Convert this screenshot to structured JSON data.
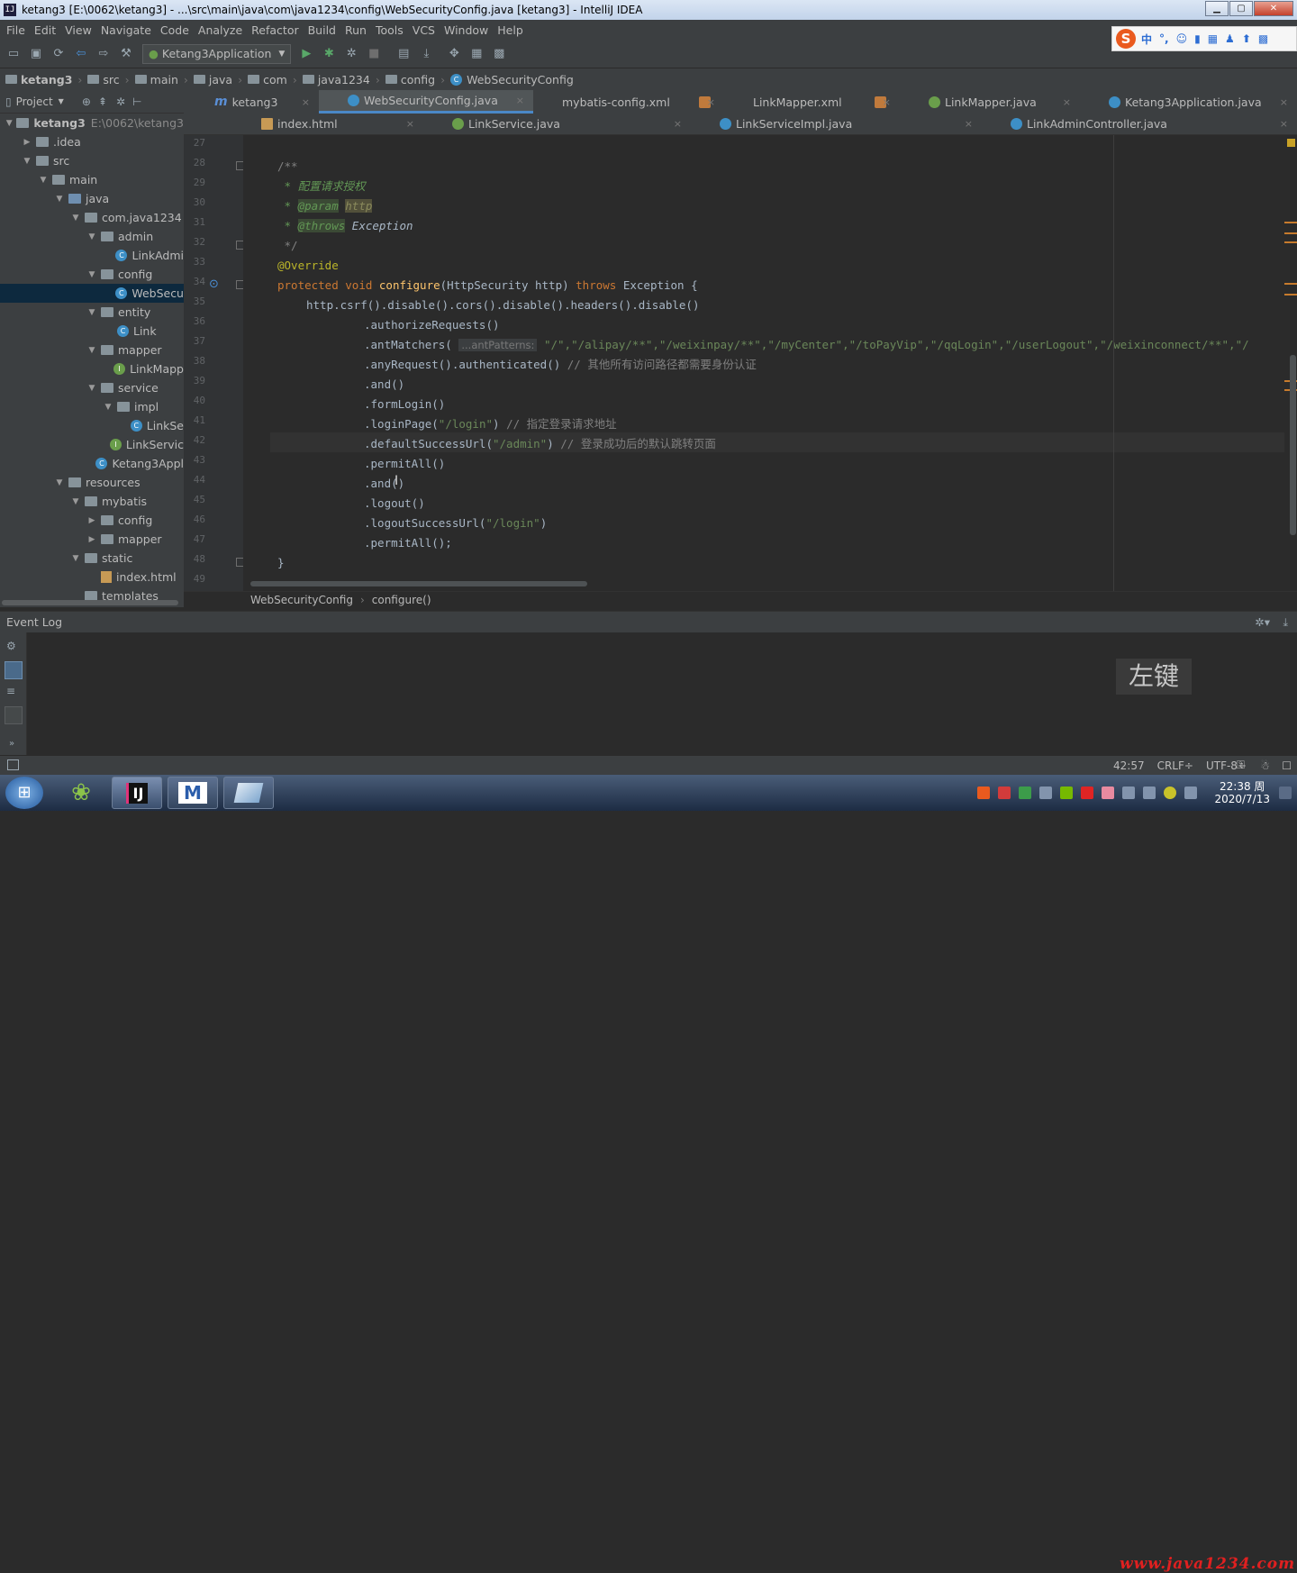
{
  "window": {
    "title": "ketang3 [E:\\0062\\ketang3] - ...\\src\\main\\java\\com\\java1234\\config\\WebSecurityConfig.java [ketang3] - IntelliJ IDEA",
    "app_icon": "IJ"
  },
  "menu": [
    "File",
    "Edit",
    "View",
    "Navigate",
    "Code",
    "Analyze",
    "Refactor",
    "Build",
    "Run",
    "Tools",
    "VCS",
    "Window",
    "Help"
  ],
  "toolbar": {
    "run_config": "Ketang3Application"
  },
  "ime": {
    "logo": "S",
    "mode": "中",
    "punct": "°,",
    "other": "☺"
  },
  "breadcrumbs": [
    "ketang3",
    "src",
    "main",
    "java",
    "com",
    "java1234",
    "config",
    "WebSecurityConfig"
  ],
  "project_panel": {
    "title": "Project"
  },
  "tree": [
    {
      "label": "ketang3",
      "suffix": "E:\\0062\\ketang3",
      "depth": 0,
      "arrow": "▼",
      "kind": "folder",
      "bold": true
    },
    {
      "label": ".idea",
      "depth": 1,
      "arrow": "▶",
      "kind": "folder"
    },
    {
      "label": "src",
      "depth": 1,
      "arrow": "▼",
      "kind": "folder"
    },
    {
      "label": "main",
      "depth": 2,
      "arrow": "▼",
      "kind": "folder"
    },
    {
      "label": "java",
      "depth": 3,
      "arrow": "▼",
      "kind": "src"
    },
    {
      "label": "com.java1234",
      "depth": 4,
      "arrow": "▼",
      "kind": "folder"
    },
    {
      "label": "admin",
      "depth": 5,
      "arrow": "▼",
      "kind": "folder"
    },
    {
      "label": "LinkAdmi",
      "depth": 6,
      "arrow": "",
      "kind": "class"
    },
    {
      "label": "config",
      "depth": 5,
      "arrow": "▼",
      "kind": "folder"
    },
    {
      "label": "WebSecu",
      "depth": 6,
      "arrow": "",
      "kind": "class",
      "selected": true
    },
    {
      "label": "entity",
      "depth": 5,
      "arrow": "▼",
      "kind": "folder"
    },
    {
      "label": "Link",
      "depth": 6,
      "arrow": "",
      "kind": "class"
    },
    {
      "label": "mapper",
      "depth": 5,
      "arrow": "▼",
      "kind": "folder"
    },
    {
      "label": "LinkMapp",
      "depth": 6,
      "arrow": "",
      "kind": "interface"
    },
    {
      "label": "service",
      "depth": 5,
      "arrow": "▼",
      "kind": "folder"
    },
    {
      "label": "impl",
      "depth": 6,
      "arrow": "▼",
      "kind": "folder"
    },
    {
      "label": "LinkSe",
      "depth": 7,
      "arrow": "",
      "kind": "class"
    },
    {
      "label": "LinkServic",
      "depth": 6,
      "arrow": "",
      "kind": "interface"
    },
    {
      "label": "Ketang3Appl",
      "depth": 5,
      "arrow": "",
      "kind": "class"
    },
    {
      "label": "resources",
      "depth": 3,
      "arrow": "▼",
      "kind": "folder"
    },
    {
      "label": "mybatis",
      "depth": 4,
      "arrow": "▼",
      "kind": "folder"
    },
    {
      "label": "config",
      "depth": 5,
      "arrow": "▶",
      "kind": "folder"
    },
    {
      "label": "mapper",
      "depth": 5,
      "arrow": "▶",
      "kind": "folder"
    },
    {
      "label": "static",
      "depth": 4,
      "arrow": "▼",
      "kind": "folder"
    },
    {
      "label": "index.html",
      "depth": 5,
      "arrow": "",
      "kind": "html"
    },
    {
      "label": "templates",
      "depth": 4,
      "arrow": "",
      "kind": "folder"
    }
  ],
  "tabs_row1": [
    {
      "label": "ketang3",
      "icon": "m",
      "width": 150
    },
    {
      "label": "WebSecurityConfig.java",
      "icon": "class",
      "width": 238,
      "active": true
    },
    {
      "label": "mybatis-config.xml",
      "icon": "xml",
      "width": 212
    },
    {
      "label": "LinkMapper.xml",
      "icon": "xml",
      "width": 195
    },
    {
      "label": "LinkMapper.java",
      "icon": "intf",
      "width": 200
    },
    {
      "label": "Ketang3Application.java",
      "icon": "class",
      "width": 241
    }
  ],
  "tabs_row2": [
    {
      "label": "index.html",
      "icon": "html",
      "width": 266
    },
    {
      "label": "LinkService.java",
      "icon": "intf",
      "width": 297
    },
    {
      "label": "LinkServiceImpl.java",
      "icon": "class",
      "width": 323
    },
    {
      "label": "LinkAdminController.java",
      "icon": "class",
      "width": 350
    }
  ],
  "line_numbers": [
    "27",
    "28",
    "29",
    "30",
    "31",
    "32",
    "33",
    "34",
    "35",
    "36",
    "37",
    "38",
    "39",
    "40",
    "41",
    "42",
    "43",
    "44",
    "45",
    "46",
    "47",
    "48",
    "49"
  ],
  "code": {
    "l28": "/**",
    "l29": " * 配置请求授权",
    "l30_pre": " * ",
    "l30_tag": "@param",
    "l30_param": "http",
    "l31_pre": " * ",
    "l31_tag": "@throws",
    "l31_rest": " Exception",
    "l32": " */",
    "l33": "@Override",
    "l34_kw1": "protected",
    "l34_kw2": "void",
    "l34_fn": "configure",
    "l34_mid": "(HttpSecurity http) ",
    "l34_kw3": "throws",
    "l34_rest": " Exception {",
    "l35": "http.csrf().disable().cors().disable().headers().disable()",
    "l36": ".authorizeRequests()",
    "l37_pre": ".antMatchers(",
    "l37_hint": "...antPatterns:",
    "l37_args": "\"/\",\"/alipay/**\",\"/weixinpay/**\",\"/myCenter\",\"/toPayVip\",\"/qqLogin\",\"/userLogout\",\"/weixinconnect/**\",\"/",
    "l38_code": ".anyRequest().authenticated()",
    "l38_cm": " // 其他所有访问路径都需要身份认证",
    "l39": ".and()",
    "l40": ".formLogin()",
    "l41_pre": ".loginPage(",
    "l41_str": "\"/login\"",
    "l41_post": ")",
    "l41_cm": " // 指定登录请求地址",
    "l42_pre": ".defaultSuccessUrl(",
    "l42_str": "\"/admin\"",
    "l42_post": ")",
    "l42_cm": " // 登录成功后的默认跳转页面",
    "l43": ".permitAll()",
    "l44": ".and()",
    "l45": ".logout()",
    "l46_pre": ".logoutSuccessUrl(",
    "l46_str": "\"/login\"",
    "l46_post": ")",
    "l47": ".permitAll();",
    "l48": "}"
  },
  "editor_breadcrumb": [
    "WebSecurityConfig",
    "configure()"
  ],
  "event_log": {
    "title": "Event Log"
  },
  "key_overlay": "左键",
  "status": {
    "position": "42:57",
    "line_sep": "CRLF÷",
    "encoding": "UTF-8÷"
  },
  "taskbar": {
    "clock_time": "22:38 周",
    "clock_date": "2020/7/13",
    "watermark": "www.java1234.com",
    "ij_label": "IJ",
    "m_label": "M"
  }
}
